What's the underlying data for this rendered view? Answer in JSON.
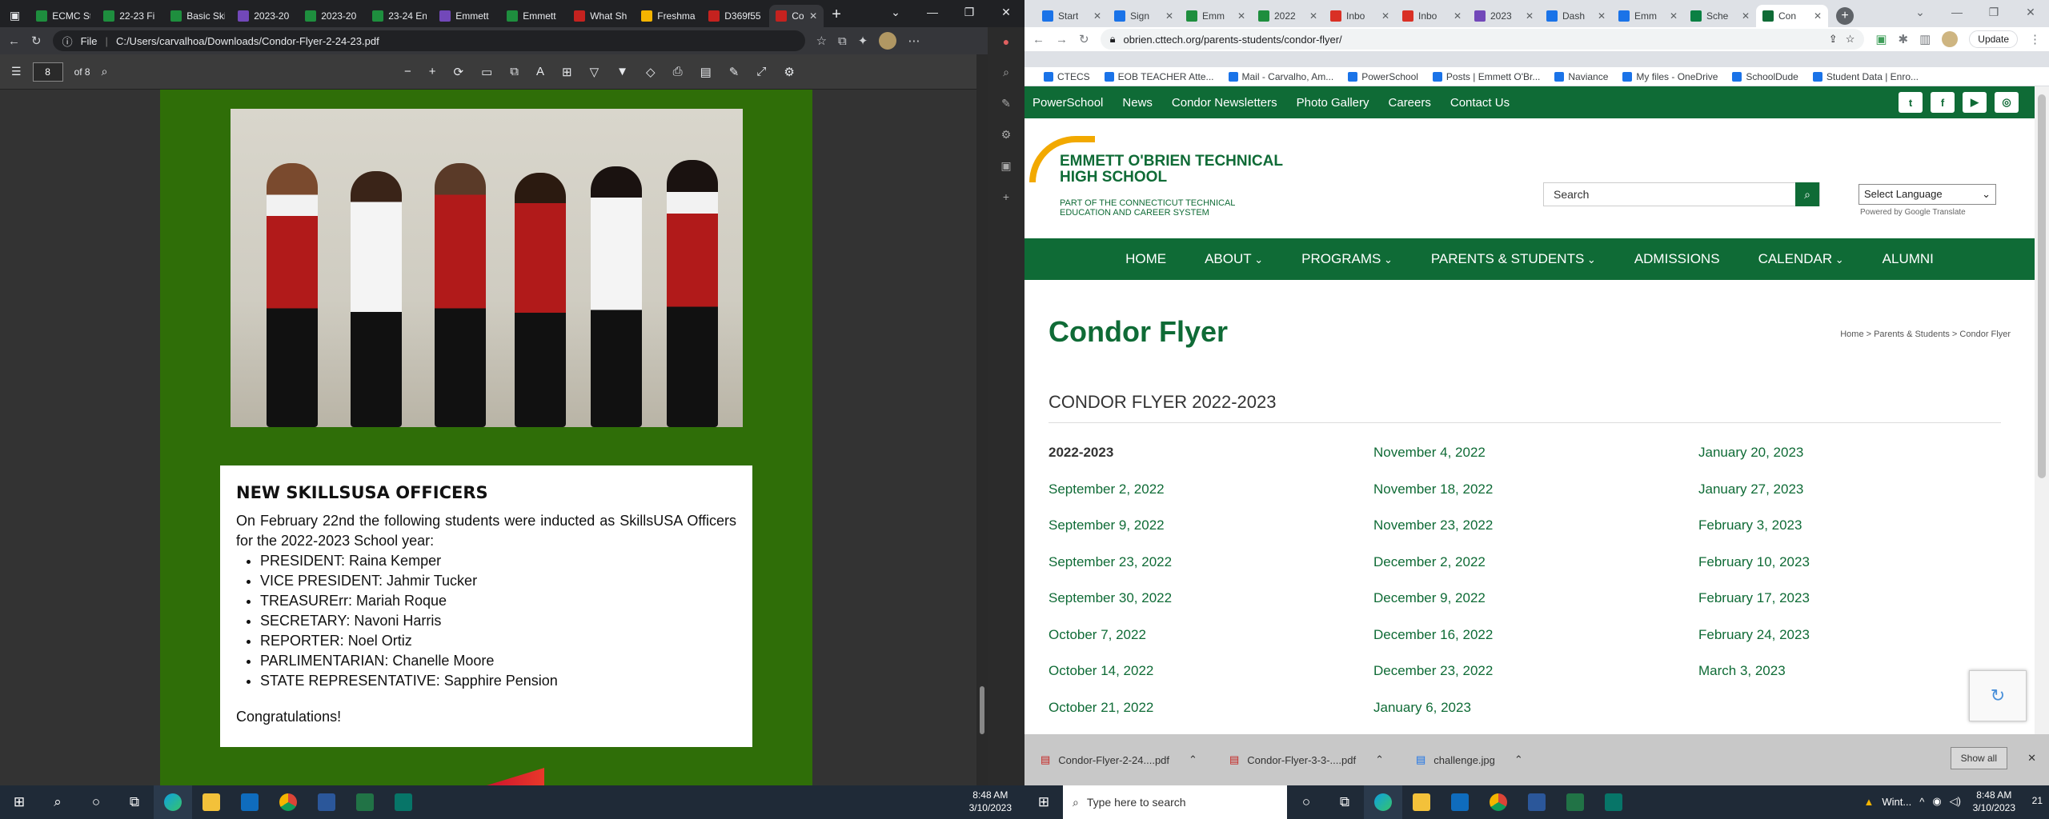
{
  "left_monitor": {
    "tabs": [
      {
        "label": "ECMC St",
        "favicon": "sheets",
        "color": "#1e8e3e"
      },
      {
        "label": "22-23 Fi",
        "favicon": "sheets",
        "color": "#1e8e3e"
      },
      {
        "label": "Basic Ski",
        "favicon": "sheets",
        "color": "#1e8e3e"
      },
      {
        "label": "2023-20",
        "favicon": "forms",
        "color": "#7248b9"
      },
      {
        "label": "2023-20",
        "favicon": "sheets",
        "color": "#1e8e3e"
      },
      {
        "label": "23-24 En",
        "favicon": "sheets",
        "color": "#1e8e3e"
      },
      {
        "label": "Emmett",
        "favicon": "forms",
        "color": "#7248b9"
      },
      {
        "label": "Emmett",
        "favicon": "sheets",
        "color": "#1e8e3e"
      },
      {
        "label": "What Sh",
        "favicon": "pdf",
        "color": "#c5221f"
      },
      {
        "label": "Freshma",
        "favicon": "slides",
        "color": "#f4b400"
      },
      {
        "label": "D369f55",
        "favicon": "pdf",
        "color": "#c5221f"
      },
      {
        "label": "Con",
        "favicon": "pdf",
        "color": "#c5221f"
      }
    ],
    "address": {
      "scheme": "File",
      "path": "C:/Users/carvalhoa/Downloads/Condor-Flyer-2-24-23.pdf"
    },
    "pdf": {
      "page_current": "8",
      "page_total": "of 8"
    },
    "article": {
      "heading": "NEW SKILLSUSA OFFICERS",
      "intro": "On February 22nd the following students were inducted as SkillsUSA Officers for the 2022-2023 School year:",
      "officers": [
        "PRESIDENT: Raina Kemper",
        "VICE PRESIDENT: Jahmir Tucker",
        "TREASURErr: Mariah Roque",
        "SECRETARY: Navoni Harris",
        "REPORTER: Noel Ortiz",
        "PARLIMENTARIAN: Chanelle Moore",
        "STATE REPRESENTATIVE: Sapphire Pension"
      ],
      "closing": "Congratulations!"
    },
    "taskbar": {
      "time": "8:48 AM",
      "date": "3/10/2023"
    }
  },
  "right_monitor": {
    "tabs": [
      {
        "label": "Start",
        "color": "#1a73e8"
      },
      {
        "label": "Sign",
        "color": "#1a73e8"
      },
      {
        "label": "Emm",
        "color": "#1e8e3e"
      },
      {
        "label": "2022",
        "color": "#1e8e3e"
      },
      {
        "label": "Inbo",
        "color": "#d93025"
      },
      {
        "label": "Inbo",
        "color": "#d93025"
      },
      {
        "label": "2023",
        "color": "#7248b9"
      },
      {
        "label": "Dash",
        "color": "#1a73e8"
      },
      {
        "label": "Emm",
        "color": "#1a73e8"
      },
      {
        "label": "Sche",
        "color": "#0b8043"
      },
      {
        "label": "Con",
        "color": "#0f6b36"
      }
    ],
    "address": "obrien.cttech.org/parents-students/condor-flyer/",
    "update_label": "Update",
    "bookmarks": [
      "CTECS",
      "EOB TEACHER Atte...",
      "Mail - Carvalho, Am...",
      "PowerSchool",
      "Posts | Emmett O'Br...",
      "Naviance",
      "My files - OneDrive",
      "SchoolDude",
      "Student Data | Enro..."
    ],
    "site": {
      "topnav": [
        "PowerSchool",
        "News",
        "Condor Newsletters",
        "Photo Gallery",
        "Careers",
        "Contact Us"
      ],
      "school_name_line1": "EMMETT O'BRIEN TECHNICAL",
      "school_name_line2": "HIGH SCHOOL",
      "school_tag_line1": "PART OF THE CONNECTICUT TECHNICAL",
      "school_tag_line2": "EDUCATION AND CAREER SYSTEM",
      "search_placeholder": "Search",
      "language": "Select Language",
      "powered": "Powered by Google Translate",
      "mainnav": [
        "HOME",
        "ABOUT",
        "PROGRAMS",
        "PARENTS & STUDENTS",
        "ADMISSIONS",
        "CALENDAR",
        "ALUMNI"
      ],
      "page_title": "Condor Flyer",
      "breadcrumb": "Home  >  Parents & Students  >  Condor Flyer",
      "section_title": "CONDOR FLYER 2022-2023",
      "col1": [
        "2022-2023",
        "September 2, 2022",
        "September 9, 2022",
        "September 23, 2022",
        "September 30, 2022",
        "October 7, 2022",
        "October 14, 2022",
        "October 21, 2022"
      ],
      "col2": [
        "November 4, 2022",
        "November 18, 2022",
        "November 23, 2022",
        "December 2, 2022",
        "December 9, 2022",
        "December 16, 2022",
        "December 23, 2022",
        "January 6, 2023"
      ],
      "col3": [
        "January 20, 2023",
        "January 27, 2023",
        "February 3, 2023",
        "February 10, 2023",
        "February 17, 2023",
        "February 24, 2023",
        "March 3, 2023"
      ]
    },
    "downloads": [
      "Condor-Flyer-2-24....pdf",
      "Condor-Flyer-3-3-....pdf",
      "challenge.jpg"
    ],
    "show_all": "Show all",
    "taskbar": {
      "search": "Type here to search",
      "weather": "Wint...",
      "time": "8:48 AM",
      "date": "3/10/2023",
      "notif": "21"
    }
  }
}
